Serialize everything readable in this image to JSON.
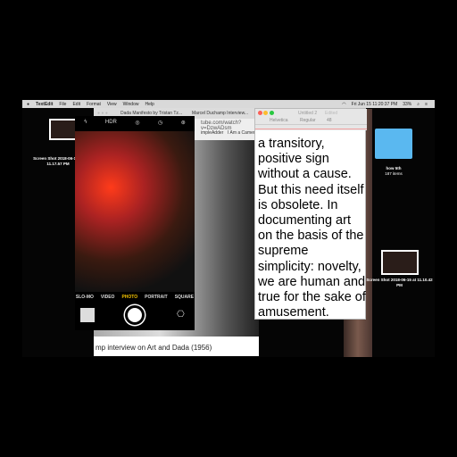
{
  "menubar": {
    "app": "TextEdit",
    "items": [
      "File",
      "Edit",
      "Format",
      "View",
      "Window",
      "Help"
    ],
    "clock": "Fri Jun 15  11:20:37 PM",
    "battery": "33%"
  },
  "desktop": {
    "icons": [
      {
        "label": "Screen Shot 2018-06-15 at 11.17.57 PM"
      },
      {
        "label": "how 5th",
        "sub": "187 items"
      },
      {
        "label": "Screen Shot 2018-06-15 at 11.10.42 PM"
      }
    ]
  },
  "browser": {
    "tabs": [
      "Dada Manifesto by Tristan Tz...",
      "Marcel Duchamp Interview..."
    ],
    "url": "tube.com/watch?v=DzwADsm",
    "bookmarks": [
      "impleAdder",
      "I Am a Camera"
    ],
    "caption": "mp interview on Art and Dada (1956)"
  },
  "camera": {
    "top_icons": [
      "flash-off-icon",
      "HDR",
      "live-photo-icon",
      "timer-icon",
      "filter-icon"
    ],
    "modes": [
      "SLO-MO",
      "VIDEO",
      "PHOTO",
      "PORTRAIT",
      "SQUARE"
    ],
    "active_mode": "PHOTO"
  },
  "textedit": {
    "title": "Untitled 2",
    "status": "Edited",
    "font": "Helvetica",
    "style": "Regular",
    "size": "48",
    "lines": [
      "a transitory,",
      "positive sign",
      "without a cause.",
      "But this need itself",
      "is obsolete. In",
      "documenting art",
      "on the basis of the",
      "supreme",
      "simplicity: novelty,",
      "we are human and",
      "true for the sake of",
      "amusement."
    ]
  }
}
